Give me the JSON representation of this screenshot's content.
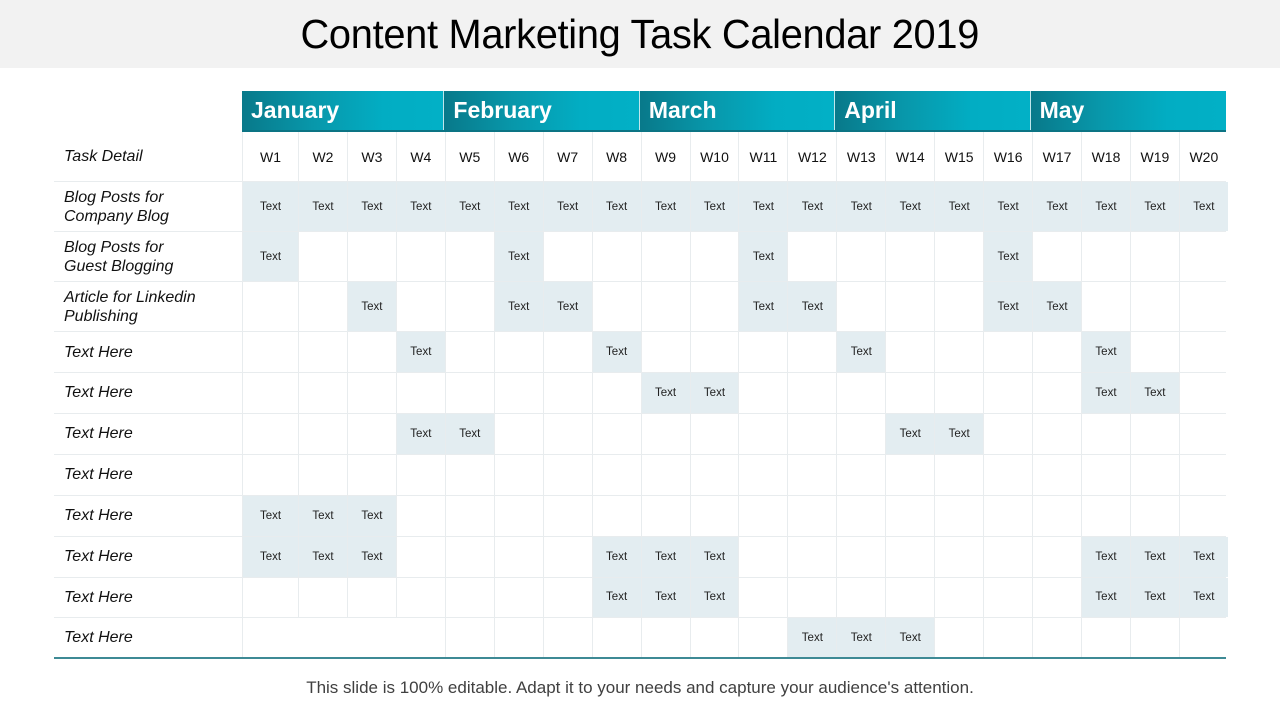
{
  "title": "Content Marketing Task Calendar 2019",
  "colors": {
    "header_gradient_start": "#08798a",
    "header_gradient_end": "#02b0c6",
    "filled_cell": "#e3edf1",
    "grid_line": "#e8ecee",
    "bottom_rule": "#3e8a95",
    "footer_text": "#404040"
  },
  "months": [
    {
      "label": "January",
      "weeks": 4
    },
    {
      "label": "February",
      "weeks": 4
    },
    {
      "label": "March",
      "weeks": 4
    },
    {
      "label": "April",
      "weeks": 4
    },
    {
      "label": "May",
      "weeks": 4
    }
  ],
  "header": {
    "task_label": "Task Detail",
    "weeks": [
      "W1",
      "W2",
      "W3",
      "W4",
      "W5",
      "W6",
      "W7",
      "W8",
      "W9",
      "W10",
      "W11",
      "W12",
      "W13",
      "W14",
      "W15",
      "W16",
      "W17",
      "W18",
      "W19",
      "W20"
    ]
  },
  "cell_text": "Text",
  "rows": [
    {
      "task": "Blog Posts for\nCompany Blog",
      "filled": [
        1,
        2,
        3,
        4,
        5,
        6,
        7,
        8,
        9,
        10,
        11,
        12,
        13,
        14,
        15,
        16,
        17,
        18,
        19,
        20
      ]
    },
    {
      "task": "Blog Posts for\nGuest Blogging",
      "filled": [
        1,
        6,
        11,
        16
      ]
    },
    {
      "task": "Article for Linkedin\nPublishing",
      "filled": [
        3,
        6,
        7,
        11,
        12,
        16,
        17
      ]
    },
    {
      "task": "Text Here",
      "filled": [
        4,
        8,
        13,
        18
      ]
    },
    {
      "task": "Text Here",
      "filled": [
        9,
        10,
        18,
        19
      ]
    },
    {
      "task": "Text Here",
      "filled": [
        4,
        5,
        14,
        15
      ]
    },
    {
      "task": "Text Here",
      "filled": []
    },
    {
      "task": "Text Here",
      "filled": [
        1,
        2,
        3
      ]
    },
    {
      "task": "Text Here",
      "filled": [
        1,
        2,
        3,
        8,
        9,
        10,
        18,
        19,
        20
      ]
    },
    {
      "task": "Text Here",
      "filled": [
        8,
        9,
        10,
        18,
        19,
        20
      ]
    },
    {
      "task": "Text Here",
      "filled": [
        12,
        13,
        14
      ]
    }
  ],
  "footer": "This slide is 100% editable. Adapt it to your needs and capture your audience's attention."
}
